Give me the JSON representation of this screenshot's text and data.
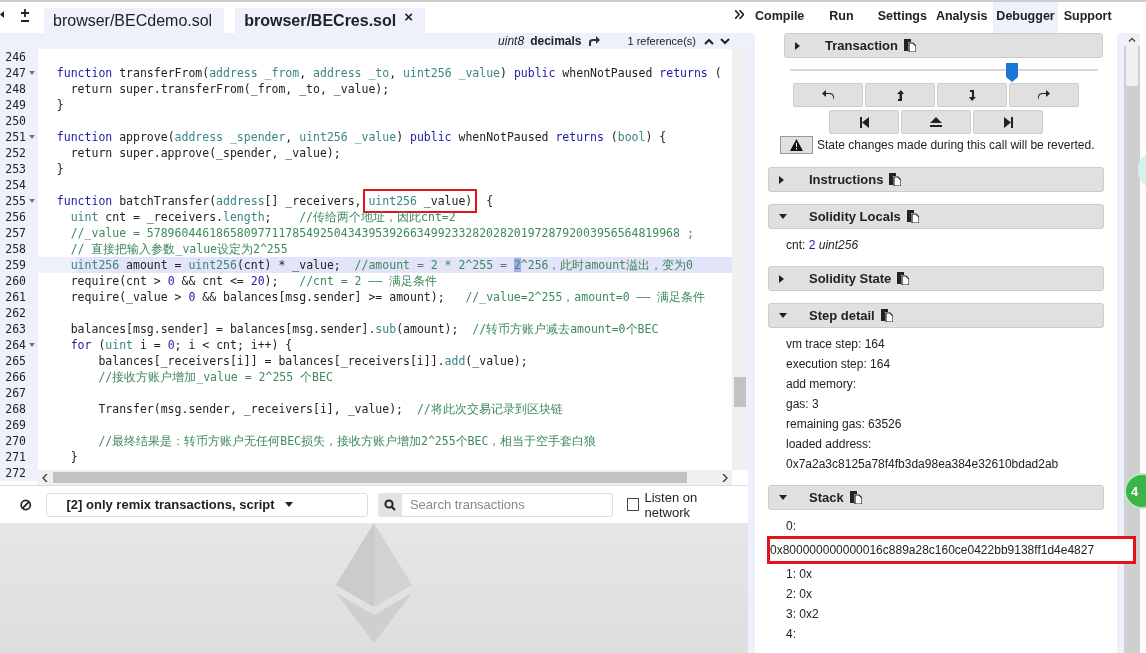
{
  "editor": {
    "tabs": [
      {
        "label": "browser/BECdemo.sol",
        "selected": false
      },
      {
        "label": "browser/BECres.sol",
        "selected": true,
        "close": "×"
      }
    ],
    "info": {
      "type": "uint8",
      "name": "decimals",
      "references": "1 reference(s)"
    },
    "lines": [
      {
        "n": "246",
        "fold": false,
        "selected": false
      },
      {
        "n": "247",
        "fold": true,
        "selected": false,
        "tokens": [
          {
            "kind": "keyword",
            "text": "  function"
          },
          {
            "kind": "plain",
            "text": " transferFrom("
          },
          {
            "kind": "type",
            "text": "address _from"
          },
          {
            "kind": "plain",
            "text": ", "
          },
          {
            "kind": "type",
            "text": "address _to"
          },
          {
            "kind": "plain",
            "text": ", "
          },
          {
            "kind": "type",
            "text": "uint256 _value"
          },
          {
            "kind": "plain",
            "text": ") "
          },
          {
            "kind": "keyword",
            "text": "public"
          },
          {
            "kind": "plain",
            "text": " whenNotPaused "
          },
          {
            "kind": "keyword",
            "text": "returns"
          },
          {
            "kind": "plain",
            "text": " ("
          }
        ]
      },
      {
        "n": "248",
        "fold": false,
        "selected": false,
        "tokens": [
          {
            "kind": "plain",
            "text": "    return super.transferFrom(_from, _to, _value);"
          }
        ]
      },
      {
        "n": "249",
        "fold": false,
        "selected": false,
        "tokens": [
          {
            "kind": "plain",
            "text": "  }"
          }
        ]
      },
      {
        "n": "250",
        "fold": false,
        "selected": false
      },
      {
        "n": "251",
        "fold": true,
        "selected": false,
        "tokens": [
          {
            "kind": "keyword",
            "text": "  function"
          },
          {
            "kind": "plain",
            "text": " approve("
          },
          {
            "kind": "type",
            "text": "address _spender"
          },
          {
            "kind": "plain",
            "text": ", "
          },
          {
            "kind": "type",
            "text": "uint256 _value"
          },
          {
            "kind": "plain",
            "text": ") "
          },
          {
            "kind": "keyword",
            "text": "public"
          },
          {
            "kind": "plain",
            "text": " whenNotPaused "
          },
          {
            "kind": "keyword",
            "text": "returns"
          },
          {
            "kind": "plain",
            "text": " ("
          },
          {
            "kind": "type",
            "text": "bool"
          },
          {
            "kind": "plain",
            "text": ") {"
          }
        ]
      },
      {
        "n": "252",
        "fold": false,
        "selected": false,
        "tokens": [
          {
            "kind": "plain",
            "text": "    return super.approve(_spender, _value);"
          }
        ]
      },
      {
        "n": "253",
        "fold": false,
        "selected": false,
        "tokens": [
          {
            "kind": "plain",
            "text": "  }"
          }
        ]
      },
      {
        "n": "254",
        "fold": false,
        "selected": false
      },
      {
        "n": "255",
        "fold": true,
        "selected": false,
        "tokens": [
          {
            "kind": "keyword",
            "text": "  function"
          },
          {
            "kind": "plain",
            "text": " batchTransfer("
          },
          {
            "kind": "type",
            "text": "address"
          },
          {
            "kind": "plain",
            "text": "[] _receivers, "
          },
          {
            "kind": "group",
            "boxed": true,
            "children": [
              {
                "kind": "type",
                "text": "uint256"
              },
              {
                "kind": "plain",
                "text": " _value)"
              }
            ]
          },
          {
            "kind": "plain",
            "text": "  {"
          }
        ]
      },
      {
        "n": "256",
        "fold": false,
        "selected": false,
        "tokens": [
          {
            "kind": "type",
            "text": "    uint"
          },
          {
            "kind": "plain",
            "text": " cnt = _receivers."
          },
          {
            "kind": "type",
            "text": "length"
          },
          {
            "kind": "plain",
            "text": ";    "
          },
          {
            "kind": "comment",
            "text": "//传给两个地址，因此cnt=2"
          }
        ]
      },
      {
        "n": "257",
        "fold": false,
        "selected": false,
        "tokens": [
          {
            "kind": "comment",
            "text": "    //_value = 57896044618658097711785492504343953926634992332820282019728792003956564819968 ;"
          }
        ]
      },
      {
        "n": "258",
        "fold": false,
        "selected": false,
        "tokens": [
          {
            "kind": "comment",
            "text": "    // 直接把输入参数_value设定为2^255"
          }
        ]
      },
      {
        "n": "259",
        "fold": false,
        "selected": true,
        "tokens": [
          {
            "kind": "type",
            "text": "    uint256"
          },
          {
            "kind": "plain",
            "text": " amount = "
          },
          {
            "kind": "type",
            "text": "uint256"
          },
          {
            "kind": "plain",
            "text": "(cnt) * _value;  "
          },
          {
            "kind": "comment",
            "text": "//amount = 2 * 2^255 = "
          },
          {
            "kind": "comment",
            "text": "2",
            "marked": true
          },
          {
            "kind": "comment",
            "text": "^256，此时amount溢出，变为0"
          }
        ]
      },
      {
        "n": "260",
        "fold": false,
        "selected": false,
        "tokens": [
          {
            "kind": "plain",
            "text": "    require(cnt > "
          },
          {
            "kind": "number",
            "text": "0"
          },
          {
            "kind": "plain",
            "text": " && cnt <= "
          },
          {
            "kind": "number",
            "text": "20"
          },
          {
            "kind": "plain",
            "text": ");   "
          },
          {
            "kind": "comment",
            "text": "//cnt = 2 —— 满足条件"
          }
        ]
      },
      {
        "n": "261",
        "fold": false,
        "selected": false,
        "tokens": [
          {
            "kind": "plain",
            "text": "    require(_value > "
          },
          {
            "kind": "number",
            "text": "0"
          },
          {
            "kind": "plain",
            "text": " && balances[msg.sender] >= amount);   "
          },
          {
            "kind": "comment",
            "text": "//_value=2^255，amount=0 —— 满足条件"
          }
        ]
      },
      {
        "n": "262",
        "fold": false,
        "selected": false
      },
      {
        "n": "263",
        "fold": false,
        "selected": false,
        "tokens": [
          {
            "kind": "plain",
            "text": "    balances[msg.sender] = balances[msg.sender]."
          },
          {
            "kind": "type",
            "text": "sub"
          },
          {
            "kind": "plain",
            "text": "(amount);  "
          },
          {
            "kind": "comment",
            "text": "//转币方账户减去amount=0个BEC"
          }
        ]
      },
      {
        "n": "264",
        "fold": true,
        "selected": false,
        "tokens": [
          {
            "kind": "keyword",
            "text": "    for"
          },
          {
            "kind": "plain",
            "text": " ("
          },
          {
            "kind": "type",
            "text": "uint"
          },
          {
            "kind": "plain",
            "text": " i = "
          },
          {
            "kind": "number",
            "text": "0"
          },
          {
            "kind": "plain",
            "text": "; i < cnt; i++) {"
          }
        ]
      },
      {
        "n": "265",
        "fold": false,
        "selected": false,
        "tokens": [
          {
            "kind": "plain",
            "text": "        balances[_receivers[i]] = balances[_receivers[i]]."
          },
          {
            "kind": "type",
            "text": "add"
          },
          {
            "kind": "plain",
            "text": "(_value);"
          }
        ]
      },
      {
        "n": "266",
        "fold": false,
        "selected": false,
        "tokens": [
          {
            "kind": "comment",
            "text": "        //接收方账户增加_value = 2^255 个BEC"
          }
        ]
      },
      {
        "n": "267",
        "fold": false,
        "selected": false
      },
      {
        "n": "268",
        "fold": false,
        "selected": false,
        "tokens": [
          {
            "kind": "plain",
            "text": "        Transfer(msg.sender, _receivers[i], _value);  "
          },
          {
            "kind": "comment",
            "text": "//将此次交易记录到区块链"
          }
        ]
      },
      {
        "n": "269",
        "fold": false,
        "selected": false
      },
      {
        "n": "270",
        "fold": false,
        "selected": false,
        "tokens": [
          {
            "kind": "comment",
            "text": "        //最终结果是：转币方账户无任何BEC损失，接收方账户增加2^255个BEC，相当于空手套白狼"
          }
        ]
      },
      {
        "n": "271",
        "fold": false,
        "selected": false,
        "tokens": [
          {
            "kind": "plain",
            "text": "    }"
          }
        ]
      },
      {
        "n": "272",
        "fold": false,
        "selected": false
      }
    ]
  },
  "terminal": {
    "filter": "[2] only remix transactions, script",
    "search": {
      "placeholder": "Search transactions"
    },
    "listen": {
      "label": "Listen on network",
      "checked": false
    }
  },
  "panel_tabs": [
    {
      "label": "Compile",
      "selected": false
    },
    {
      "label": "Run",
      "selected": false
    },
    {
      "label": "Settings",
      "selected": false
    },
    {
      "label": "Analysis",
      "selected": false
    },
    {
      "label": "Debugger",
      "selected": true
    },
    {
      "label": "Support",
      "selected": false
    }
  ],
  "debugger": {
    "transaction": {
      "title": "Transaction",
      "expanded": false
    },
    "slider": {
      "level": 0.72
    },
    "warning": "State changes made during this call will be reverted.",
    "sections": [
      {
        "title": "Instructions",
        "expanded": false,
        "kind": "plain"
      },
      {
        "title": "Solidity Locals",
        "expanded": true,
        "kind": "locals",
        "items": [
          {
            "name": "cnt:",
            "value": "2",
            "type": "uint256"
          }
        ]
      },
      {
        "title": "Solidity State",
        "expanded": false,
        "kind": "plain"
      },
      {
        "title": "Step detail",
        "expanded": true,
        "kind": "lines",
        "items": [
          {
            "text": "vm trace step: 164",
            "boxed": false
          },
          {
            "text": "execution step: 164",
            "boxed": false
          },
          {
            "text": "add memory:",
            "boxed": false
          },
          {
            "text": "gas: 3",
            "boxed": false
          },
          {
            "text": "remaining gas: 63526",
            "boxed": false
          },
          {
            "text": "loaded address:",
            "boxed": false
          },
          {
            "text": "0x7a2a3c8125a78f4fb3da98ea384e32610bdad2ab",
            "boxed": false
          }
        ]
      },
      {
        "title": "Stack",
        "expanded": true,
        "kind": "lines",
        "items": [
          {
            "text": "0:",
            "boxed": false
          },
          {
            "text": "0x800000000000016c889a28c160ce0422bb9138ff1d4e4827",
            "boxed": true
          },
          {
            "text": "1: 0x",
            "boxed": false
          },
          {
            "text": "2: 0x",
            "boxed": false
          },
          {
            "text": "3: 0x2",
            "boxed": false
          },
          {
            "text": "4:",
            "boxed": false
          }
        ]
      }
    ]
  },
  "badge": "4"
}
